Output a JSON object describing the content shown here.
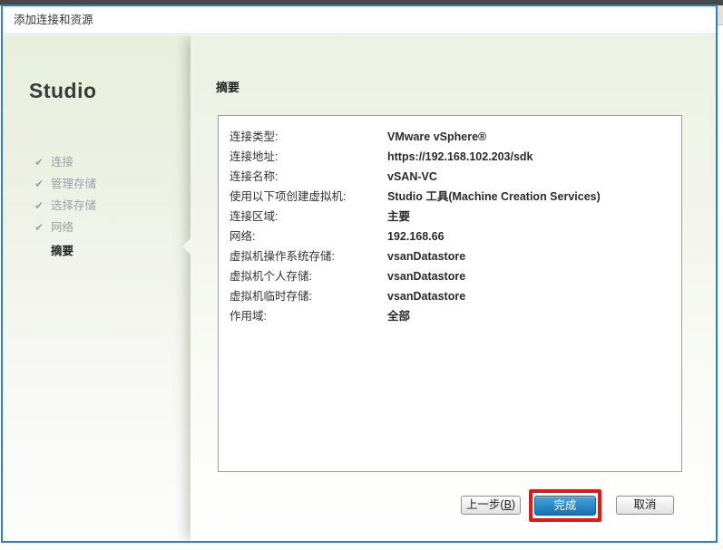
{
  "window": {
    "title": "添加连接和资源"
  },
  "sidebar": {
    "brand": "Studio",
    "check_icon": "✔",
    "steps": [
      {
        "label": "连接"
      },
      {
        "label": "管理存储"
      },
      {
        "label": "选择存储"
      },
      {
        "label": "网络"
      },
      {
        "label": "摘要"
      }
    ]
  },
  "main": {
    "heading": "摘要",
    "summary_rows": [
      {
        "label": "连接类型:",
        "value": "VMware vSphere®"
      },
      {
        "label": "连接地址:",
        "value": "https://192.168.102.203/sdk"
      },
      {
        "label": "连接名称:",
        "value": "vSAN-VC"
      },
      {
        "label": "使用以下项创建虚拟机:",
        "value": "Studio 工具(Machine Creation Services)"
      },
      {
        "label": "连接区域:",
        "value": "主要"
      },
      {
        "label": "网络:",
        "value": "192.168.66"
      },
      {
        "label": "虚拟机操作系统存储:",
        "value": "vsanDatastore"
      },
      {
        "label": "虚拟机个人存储:",
        "value": "vsanDatastore"
      },
      {
        "label": "虚拟机临时存储:",
        "value": "vsanDatastore"
      },
      {
        "label": "作用域:",
        "value": "全部"
      }
    ]
  },
  "buttons": {
    "back_prefix": "上一步(",
    "back_key": "B",
    "back_suffix": ")",
    "finish": "完成",
    "cancel": "取消"
  },
  "colors": {
    "window_border": "#2b80c5",
    "annotation_red": "#e01a1a",
    "finish_blue_top": "#4ba4dc",
    "finish_blue_bottom": "#1d6fae"
  }
}
